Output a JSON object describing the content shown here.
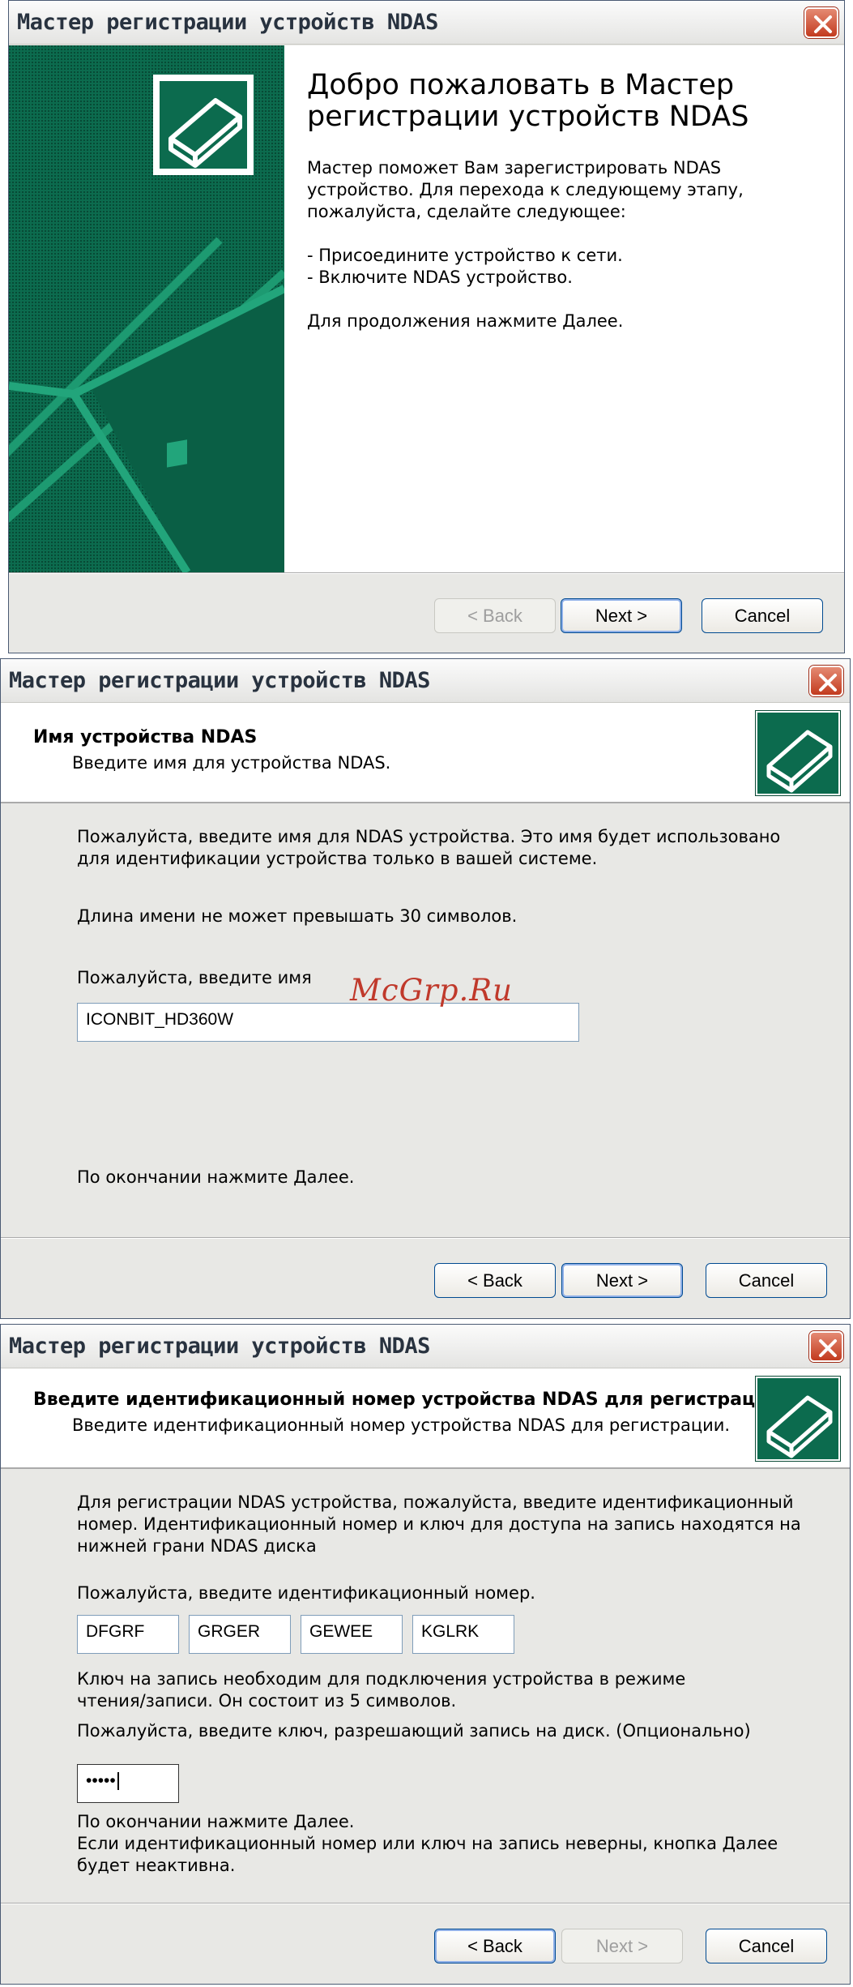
{
  "window_title": "Мастер регистрации устройств NDAS",
  "buttons": {
    "back": "< Back",
    "next": "Next >",
    "cancel": "Cancel"
  },
  "dialog1": {
    "title": "Добро пожаловать в Мастер\nрегистрации устройств NDAS",
    "text": "Мастер поможет Вам зарегистрировать NDAS\nустройство. Для перехода к следующему этапу,\nпожалуйста, сделайте следующее:\n\n- Присоедините устройство к сети.\n- Включите NDAS устройство.\n\nДля продолжения нажмите Далее."
  },
  "dialog2": {
    "header_title": "Имя устройства NDAS",
    "header_subtitle": "Введите имя для устройства NDAS.",
    "paragraph1": "Пожалуйста, введите имя для NDAS устройства. Это имя будет использовано\nдля идентификации устройства только в вашей системе.",
    "paragraph2": "Длина имени не может превышать 30 символов.",
    "name_label": "Пожалуйста, введите имя",
    "name_value": "ICONBIT_HD360W",
    "footer": "По окончании нажмите Далее."
  },
  "dialog3": {
    "header_title": "Введите идентификационный номер устройства NDAS для регистрации.",
    "header_subtitle": "Введите идентификационный номер устройства NDAS для регистрации.",
    "paragraph1": "Для регистрации NDAS устройства, пожалуйста, введите идентификационный\nномер. Идентификационный номер и ключ для доступа на запись находятся на\nнижней грани NDAS диска",
    "id_label": "Пожалуйста, введите идентификационный номер.",
    "id_parts": [
      "DFGRF",
      "GRGER",
      "GEWEE",
      "KGLRK"
    ],
    "key_note": "Ключ на запись необходим для подключения устройства в режиме\nчтения/записи. Он состоит из 5 символов.",
    "key_label": "Пожалуйста, введите ключ, разрешающий запись на диск. (Опционально)",
    "key_value": "•••••",
    "footer": "По окончании нажмите Далее.\nЕсли идентификационный номер или ключ на запись неверны, кнопка Далее\nбудет неактивна."
  },
  "watermark": "McGrp.Ru",
  "colors": {
    "accent_green": "#0c6b4e",
    "window_bg": "#e8e8e5",
    "close_red": "#c33b1f",
    "watermark_red": "#c0392b"
  }
}
